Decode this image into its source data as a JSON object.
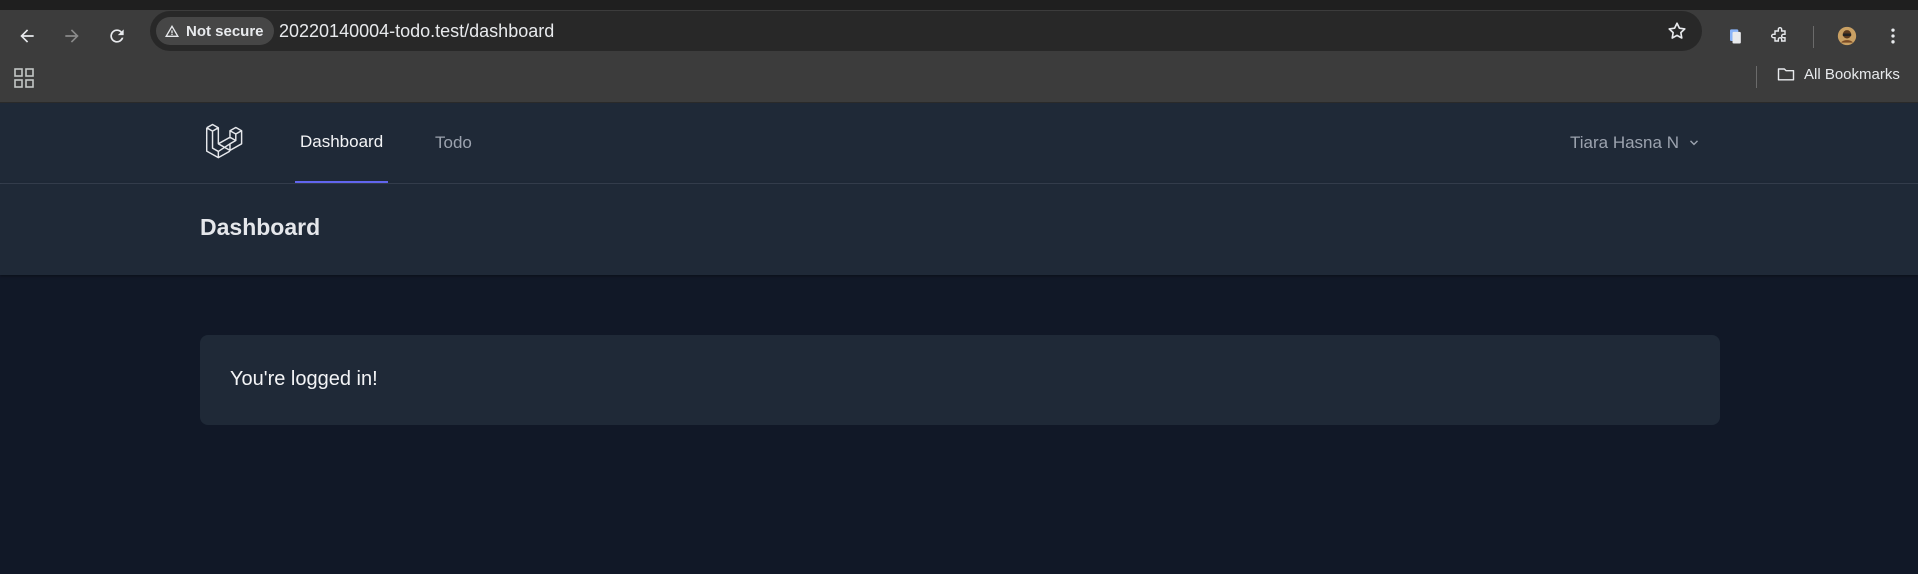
{
  "browser": {
    "security_label": "Not secure",
    "url": "20220140004-todo.test/dashboard",
    "bookmarks_label": "All Bookmarks"
  },
  "nav": {
    "links": [
      {
        "label": "Dashboard",
        "active": true
      },
      {
        "label": "Todo",
        "active": false
      }
    ],
    "user_name": "Tiara Hasna N"
  },
  "header": {
    "title": "Dashboard"
  },
  "card": {
    "message": "You're logged in!"
  },
  "colors": {
    "page_bg": "#111827",
    "panel_bg": "#1f2937",
    "accent": "#6366f1"
  }
}
